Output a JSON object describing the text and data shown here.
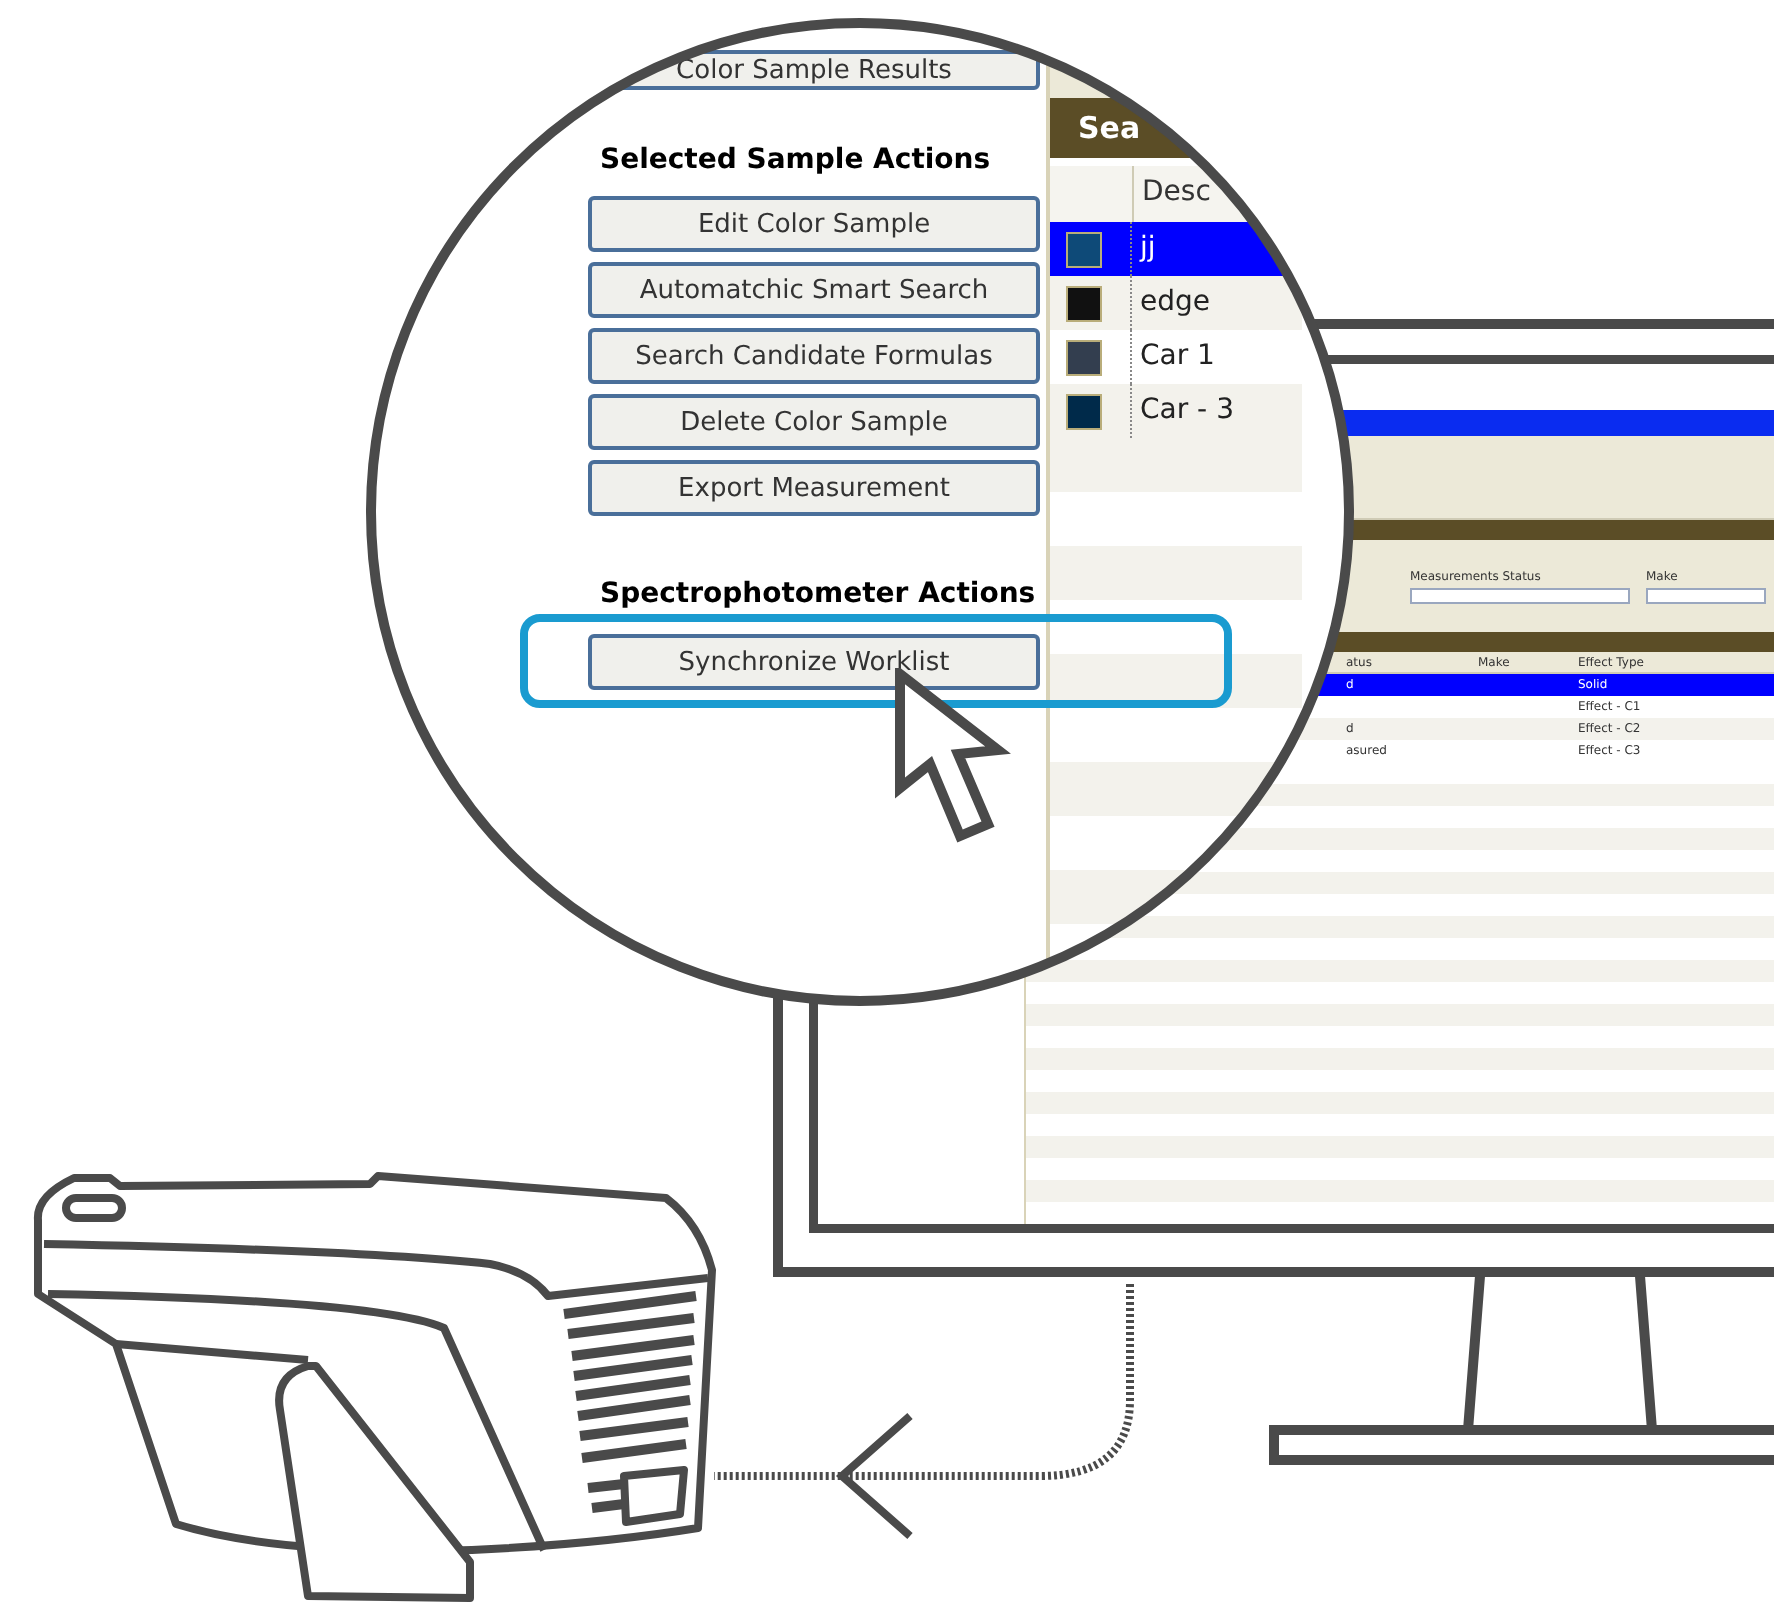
{
  "magnifier": {
    "top_button": "Color Sample Results",
    "sections": [
      {
        "heading": "Selected Sample Actions",
        "buttons": [
          {
            "label": "Edit Color Sample",
            "highlighted": false
          },
          {
            "label": "Automatchic Smart Search",
            "highlighted": false
          },
          {
            "label": "Search Candidate Formulas",
            "highlighted": false
          },
          {
            "label": "Delete Color Sample",
            "highlighted": false
          },
          {
            "label": "Export Measurement",
            "highlighted": false
          }
        ]
      },
      {
        "heading": "Spectrophotometer Actions",
        "buttons": [
          {
            "label": "Synchronize Worklist",
            "highlighted": true
          }
        ]
      }
    ],
    "grid": {
      "title": "Sea",
      "column": "Desc",
      "rows": [
        {
          "name": "jj",
          "color": "#0e4a78",
          "selected": true
        },
        {
          "name": "edge",
          "color": "#111111",
          "selected": false
        },
        {
          "name": "Car 1",
          "color": "#333e4f",
          "selected": false
        },
        {
          "name": "Car - 3",
          "color": "#002a4a",
          "selected": false
        }
      ]
    }
  },
  "monitor_screen": {
    "filters": [
      "Measurements Status",
      "Make"
    ],
    "columns": [
      "atus",
      "Make",
      "Effect Type"
    ],
    "rows": [
      {
        "status": "d",
        "effect": "Solid",
        "selected": true
      },
      {
        "effect": "Effect - C1",
        "selected": false
      },
      {
        "status": "d",
        "effect": "Effect - C2",
        "selected": false
      },
      {
        "status": "asured",
        "effect": "Effect - C3",
        "selected": false
      }
    ]
  }
}
